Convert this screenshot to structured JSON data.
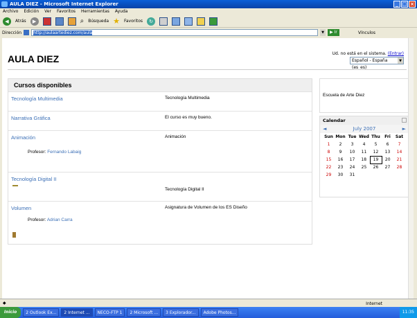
{
  "window": {
    "title": "AULA DIEZ - Microsoft Internet Explorer"
  },
  "menu": [
    "Archivo",
    "Edición",
    "Ver",
    "Favoritos",
    "Herramientas",
    "Ayuda"
  ],
  "toolbar": {
    "back": "Atrás",
    "search": "Búsqueda",
    "favorites": "Favoritos"
  },
  "address": {
    "label": "Dirección",
    "url": "http://aulaartediez.com/aula",
    "go": "Ir",
    "links": "Vínculos"
  },
  "site": {
    "title": "AULA DIEZ",
    "login_text": "Ud. no está en el sistema.",
    "login_link": "(Entrar)",
    "language": "Español - España (es_es)"
  },
  "courses": {
    "heading": "Cursos disponibles",
    "items": [
      {
        "name": "Tecnología Multimedia",
        "summary": "Tecnología Multimedia",
        "teacher_label": "",
        "teacher": ""
      },
      {
        "name": "Narrativa Gráfica",
        "summary": "El curso es muy bueno.",
        "teacher_label": "",
        "teacher": ""
      },
      {
        "name": "Animación",
        "summary": "Animación",
        "teacher_label": "Profesor:",
        "teacher": "Fernando Labaig"
      },
      {
        "name": "Tecnología Digital II",
        "summary": "Tecnología Digital II",
        "teacher_label": "",
        "teacher": ""
      },
      {
        "name": "Volumen",
        "summary": "Asignatura de Volumen de los ES Diseño",
        "teacher_label": "Profesor:",
        "teacher": "Adrian Carra"
      }
    ]
  },
  "sidebar": {
    "school": "Escuela de Arte Diez"
  },
  "calendar": {
    "title": "Calendar",
    "month": "July 2007",
    "days": [
      "Sun",
      "Mon",
      "Tue",
      "Wed",
      "Thu",
      "Fri",
      "Sat"
    ],
    "weeks": [
      [
        "1",
        "2",
        "3",
        "4",
        "5",
        "6",
        "7"
      ],
      [
        "8",
        "9",
        "10",
        "11",
        "12",
        "13",
        "14"
      ],
      [
        "15",
        "16",
        "17",
        "18",
        "19",
        "20",
        "21"
      ],
      [
        "22",
        "23",
        "24",
        "25",
        "26",
        "27",
        "28"
      ],
      [
        "29",
        "30",
        "31",
        "",
        "",
        "",
        ""
      ]
    ],
    "today": "19"
  },
  "status": {
    "zone": "Internet"
  },
  "taskbar": {
    "start": "Inicio",
    "tasks": [
      "2 Outlook Ex...",
      "2 Internet ...",
      "NECO-FTP 1",
      "2 Microsoft ...",
      "3 Explorador...",
      "Adobe Photos..."
    ],
    "clock": "11:35"
  }
}
